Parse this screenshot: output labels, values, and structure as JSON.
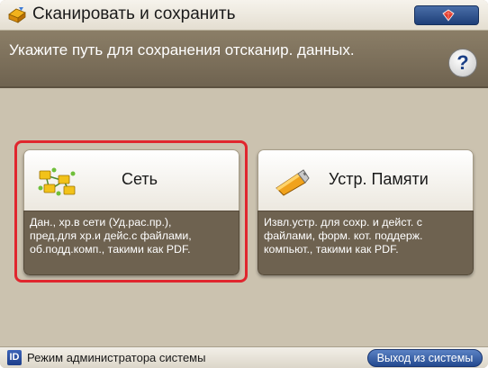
{
  "header": {
    "title": "Сканировать и сохранить",
    "title_icon": "scan-save-icon",
    "corner_button_icon": "counter-gem-icon"
  },
  "instruction": {
    "text": "Укажите путь для сохранения отсканир. данных.",
    "help_label": "?"
  },
  "options": [
    {
      "label": "Сеть",
      "icon": "network-folders-icon",
      "selected": true,
      "description": [
        "Дан., хр.в сети (Уд.рас.пр.),",
        "пред.для хр.и дейс.с файлами,",
        "об.подд.комп., такими как PDF."
      ]
    },
    {
      "label": "Устр. Памяти",
      "icon": "usb-memory-icon",
      "selected": false,
      "description": [
        "Извл.устр. для сохр. и дейст. с",
        "файлами, форм. кот. поддерж.",
        "компьют., такими как PDF."
      ]
    }
  ],
  "statusbar": {
    "id_badge": "ID",
    "mode_text": "Режим администратора системы",
    "logout_label": "Выход из системы"
  },
  "colors": {
    "selection_border": "#e0262e",
    "instruction_bg": "#7d705b",
    "accent_blue": "#23498f"
  }
}
